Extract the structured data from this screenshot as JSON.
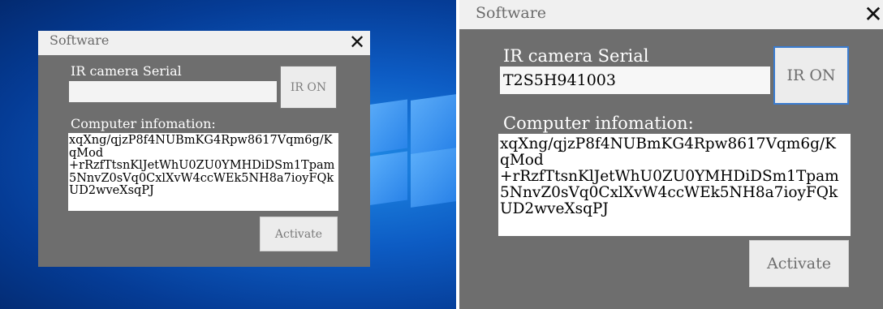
{
  "left_dialog": {
    "title": "Software",
    "close_glyph": "✕",
    "serial_label": "IR camera Serial",
    "serial_value": "",
    "ir_button_label": "IR ON",
    "computer_info_label": "Computer infomation:",
    "computer_info_lines": [
      "xqXng/qjzP8f4NUBmKG4Rpw8617Vqm6g/K",
      "qMod",
      "+rRzfTtsnKlJetWhU0ZU0YMHDiDSm1Tpam",
      "5NnvZ0sVq0CxlXvW4ccWEk5NH8a7ioyFQk",
      "UD2wveXsqPJ"
    ],
    "activate_button_label": "Activate"
  },
  "right_dialog": {
    "title": "Software",
    "close_glyph": "✕",
    "serial_label": "IR camera Serial",
    "serial_value": "T2S5H941003",
    "ir_button_label": "IR ON",
    "computer_info_label": "Computer infomation:",
    "computer_info_lines": [
      "xqXng/qjzP8f4NUBmKG4Rpw8617Vqm6g/K",
      "qMod",
      "+rRzfTtsnKlJetWhU0ZU0YMHDiDSm1Tpam",
      "5NnvZ0sVq0CxlXvW4ccWEk5NH8a7ioyFQk",
      "UD2wveXsqPJ"
    ],
    "activate_button_label": "Activate"
  },
  "colors": {
    "dialog_body": "#6e6e6e",
    "titlebar": "#f0f0f0",
    "desktop_blue": "#0d5cc4",
    "focus_border": "#3a7cd0"
  }
}
